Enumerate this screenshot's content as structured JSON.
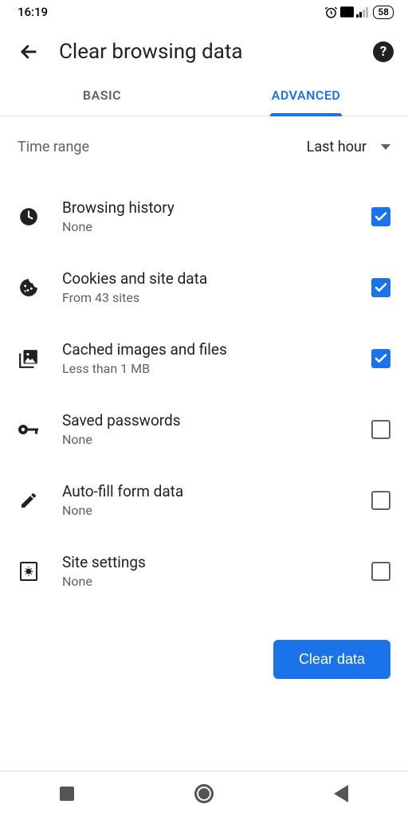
{
  "status": {
    "time": "16:19",
    "battery": "58"
  },
  "header": {
    "title": "Clear browsing data"
  },
  "tabs": {
    "basic": "BASIC",
    "advanced": "ADVANCED"
  },
  "timeRange": {
    "label": "Time range",
    "value": "Last hour"
  },
  "items": [
    {
      "title": "Browsing history",
      "sub": "None",
      "checked": true
    },
    {
      "title": "Cookies and site data",
      "sub": "From 43 sites",
      "checked": true
    },
    {
      "title": "Cached images and files",
      "sub": "Less than 1 MB",
      "checked": true
    },
    {
      "title": "Saved passwords",
      "sub": "None",
      "checked": false
    },
    {
      "title": "Auto-fill form data",
      "sub": "None",
      "checked": false
    },
    {
      "title": "Site settings",
      "sub": "None",
      "checked": false
    }
  ],
  "clearButton": "Clear data"
}
